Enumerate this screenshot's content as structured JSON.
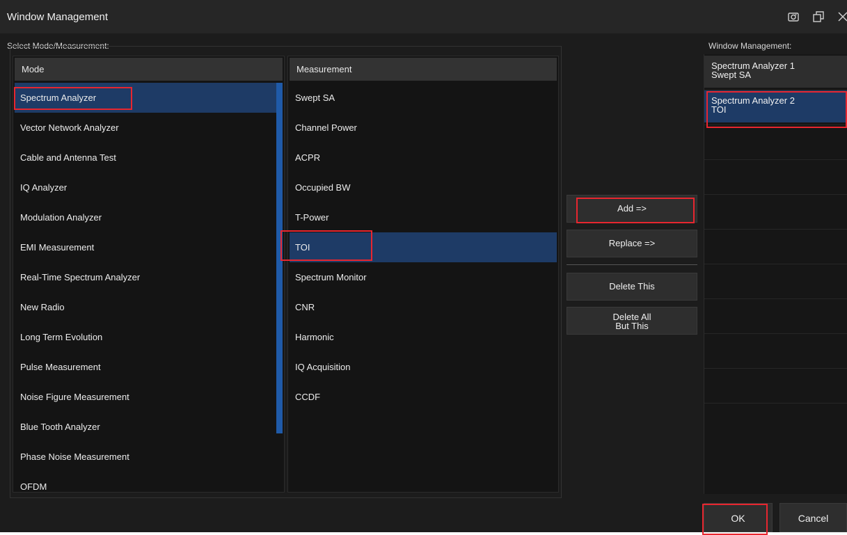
{
  "window": {
    "title": "Window Management",
    "icons": [
      "camera-icon",
      "restore-icon",
      "close-icon"
    ]
  },
  "select": {
    "label": "Select Mode/Measurement:",
    "mode_header": "Mode",
    "measurement_header": "Measurement",
    "modes": [
      "Spectrum Analyzer",
      "Vector Network Analyzer",
      "Cable and Antenna Test",
      "IQ Analyzer",
      "Modulation Analyzer",
      "EMI Measurement",
      "Real-Time Spectrum Analyzer",
      "New Radio",
      "Long Term Evolution",
      "Pulse Measurement",
      "Noise Figure Measurement",
      "Blue Tooth Analyzer",
      "Phase Noise Measurement",
      "OFDM"
    ],
    "selected_mode": "Spectrum Analyzer",
    "measurements": [
      "Swept SA",
      "Channel Power",
      "ACPR",
      "Occupied BW",
      "T-Power",
      "TOI",
      "Spectrum Monitor",
      "CNR",
      "Harmonic",
      "IQ Acquisition",
      "CCDF"
    ],
    "selected_measurement": "TOI"
  },
  "actions": {
    "add": "Add   =>",
    "replace": "Replace  =>",
    "delete_this": "Delete This",
    "delete_all_line1": "Delete All",
    "delete_all_line2": "But This"
  },
  "window_management": {
    "label": "Window Management:",
    "items": [
      {
        "line1": "Spectrum Analyzer 1",
        "line2": "Swept SA",
        "selected": false
      },
      {
        "line1": "Spectrum Analyzer 2",
        "line2": "TOI",
        "selected": true
      }
    ],
    "empty_slots": 8
  },
  "footer": {
    "ok": "OK",
    "cancel": "Cancel"
  },
  "colors": {
    "selection": "#1e3b66",
    "highlight": "#e8262f",
    "scrollbar": "#1f5aa8"
  }
}
